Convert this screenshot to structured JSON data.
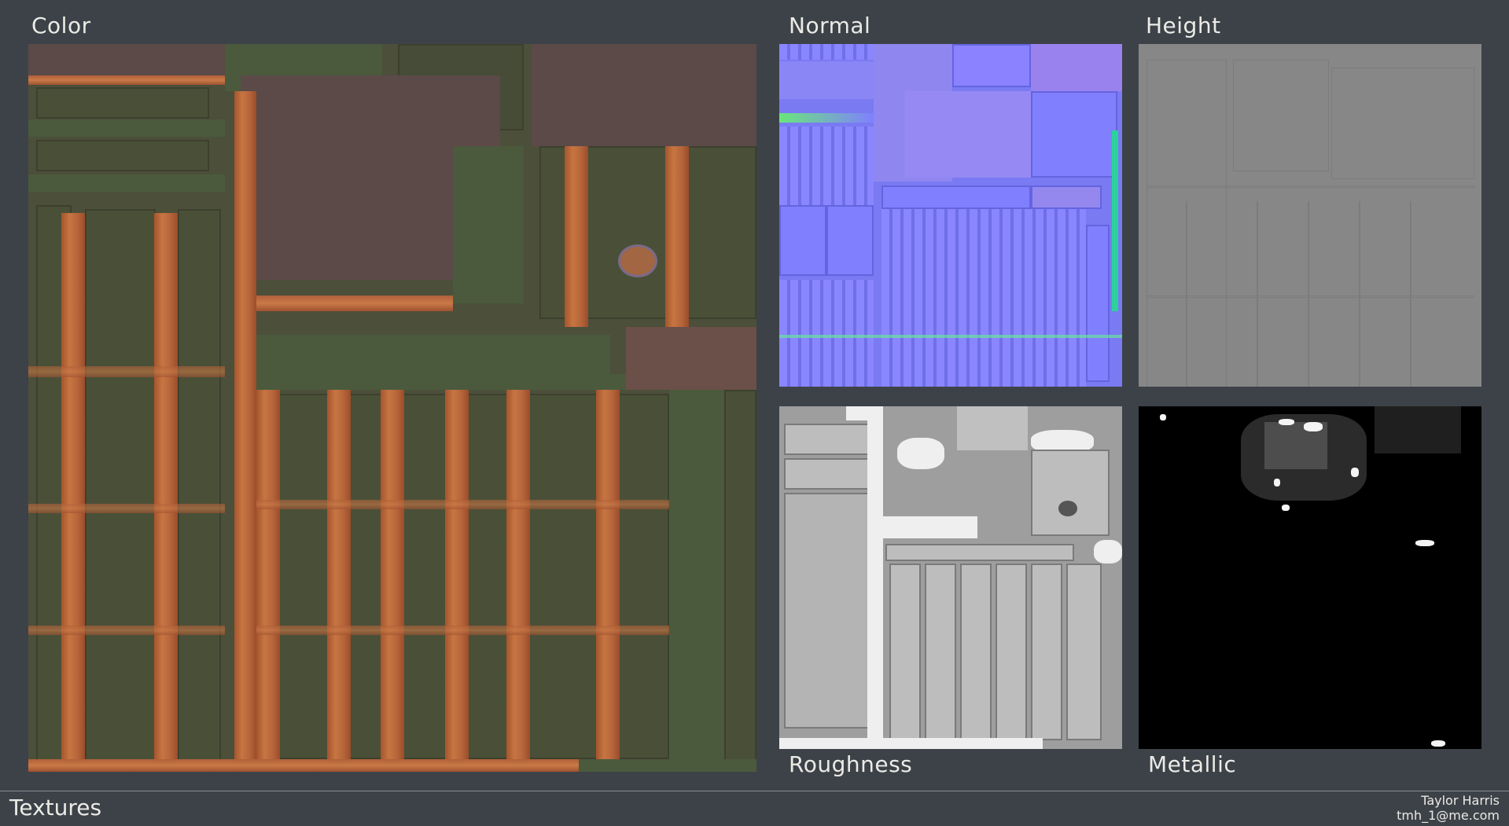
{
  "labels": {
    "color": "Color",
    "normal": "Normal",
    "height": "Height",
    "roughness": "Roughness",
    "metallic": "Metallic"
  },
  "footer": {
    "title": "Textures",
    "author_name": "Taylor Harris",
    "author_email": "tmh_1@me.com"
  },
  "colors": {
    "background": "#3d4248",
    "text": "#ebebe6"
  }
}
